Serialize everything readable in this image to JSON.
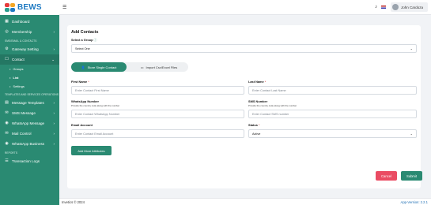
{
  "brand": {
    "logo_text": "BEWS",
    "colors": {
      "primary": "#2a8a72",
      "danger": "#ea4c63",
      "logo": "#1f7ac2"
    }
  },
  "sidebar": {
    "items": [
      {
        "label": "Dashboard",
        "icon": "dashboard-icon"
      },
      {
        "label": "Membership",
        "icon": "membership-icon"
      }
    ],
    "section_sms": "SMS/EMAIL & CONTACTS",
    "gateway": {
      "label": "Gateway Setting",
      "icon": "gateway-icon"
    },
    "contact": {
      "label": "Contact",
      "icon": "contact-icon"
    },
    "contact_sub": [
      "Groups",
      "List",
      "Settings"
    ],
    "section_templates": "TEMPLATES AND SERVICES OPERATIONS",
    "items2": [
      {
        "label": "Message Templates",
        "icon": "template-icon"
      },
      {
        "label": "SMS Message",
        "icon": "sms-icon"
      },
      {
        "label": "WhatsApp Message",
        "icon": "whatsapp-icon"
      },
      {
        "label": "Mail Control",
        "icon": "mail-icon"
      },
      {
        "label": "WhatsApp Business",
        "icon": "whatsapp-business-icon"
      }
    ],
    "section_reports": "REPORTS",
    "transaction_logs": {
      "label": "Transaction Logs",
      "icon": "logs-icon"
    }
  },
  "header": {
    "user_name": "John Cardoza"
  },
  "form": {
    "title": "Add Contacts",
    "group_label": "Select a Group",
    "group_value": "Select One",
    "tab_single": "Store Single Contact",
    "tab_import": "Import Csv/Excel Files",
    "first_name": {
      "label": "First Name",
      "placeholder": "Enter Contact First Name"
    },
    "last_name": {
      "label": "Last Name",
      "placeholder": "Enter Contact Last Name"
    },
    "whatsapp": {
      "label": "WhatsApp Number",
      "hint": "Provide the country code along with the number",
      "placeholder": "Enter Contact WhatsApp Number"
    },
    "sms": {
      "label": "SMS Number",
      "hint": "Provide the country code along with the number",
      "placeholder": "Enter Contact SMS number"
    },
    "email": {
      "label": "Email Account",
      "placeholder": "Enter Contact Email Account"
    },
    "status": {
      "label": "Status",
      "value": "Active"
    },
    "add_more": "Add More Attributes",
    "cancel": "Cancel",
    "submit": "Submit"
  },
  "footer": {
    "copyright": "Invetics © 2024",
    "version": "App-Version: 2.2.1"
  }
}
